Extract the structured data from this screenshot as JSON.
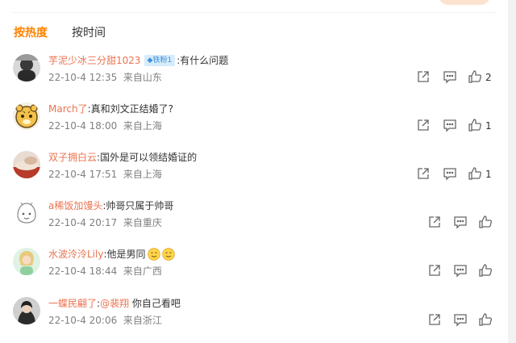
{
  "tabs": [
    {
      "label": "按热度",
      "active": true
    },
    {
      "label": "按时间",
      "active": false
    }
  ],
  "comments": [
    {
      "user": "芋泥少冰三分甜1023",
      "badge": "铁粉1",
      "sep": ":",
      "text": "有什么问题",
      "time": "22-10-4 12:35",
      "location": "来自山东",
      "likes": "2"
    },
    {
      "user": "March了",
      "sep": ":",
      "text": "真和刘文正结婚了?",
      "time": "22-10-4 18:00",
      "location": "来自上海",
      "likes": "1"
    },
    {
      "user": "双子拥白云",
      "sep": ":",
      "text": "国外是可以领结婚证的",
      "time": "22-10-4 17:51",
      "location": "来自上海",
      "likes": "1"
    },
    {
      "user": "a稀饭加馒头",
      "sep": ":",
      "text": "帅哥只属于帅哥",
      "time": "22-10-4 20:17",
      "location": "来自重庆"
    },
    {
      "user": "水波泠泠Lily",
      "sep": ":",
      "text": "他是男同",
      "emoji": [
        "smile-emoji",
        "smile-emoji"
      ],
      "time": "22-10-4 18:44",
      "location": "来自广西"
    },
    {
      "user": "一蝶民翩了",
      "sep": ":",
      "mention": "@裴翔",
      "text": " 你自己看吧",
      "time": "22-10-4 20:06",
      "location": "来自浙江"
    }
  ],
  "icons": {
    "share": "share-icon",
    "reply": "comment-icon",
    "like": "thumbs-up-icon"
  },
  "colors": {
    "accent": "#ff8200",
    "username": "#eb7350",
    "meta": "#808080"
  }
}
